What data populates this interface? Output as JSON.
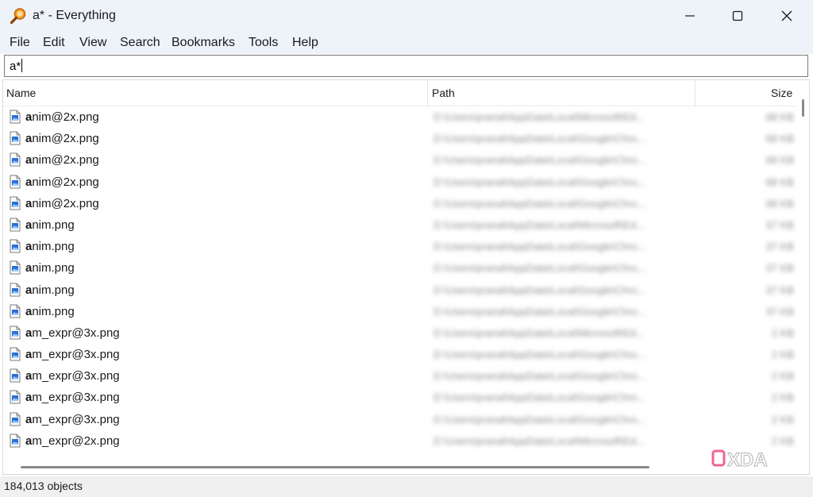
{
  "window": {
    "title": "a* - Everything"
  },
  "menu": [
    "File",
    "Edit",
    "View",
    "Search",
    "Bookmarks",
    "Tools",
    "Help"
  ],
  "search": {
    "value": "a*"
  },
  "columns": {
    "name": "Name",
    "path": "Path",
    "size": "Size"
  },
  "rows": [
    {
      "bold": "a",
      "rest": "nim@2x.png",
      "path": "D:\\Users\\pranal\\AppData\\Local\\Microsoft\\Ed...",
      "size": "68 KB"
    },
    {
      "bold": "a",
      "rest": "nim@2x.png",
      "path": "D:\\Users\\pranal\\AppData\\Local\\Google\\Chro...",
      "size": "68 KB"
    },
    {
      "bold": "a",
      "rest": "nim@2x.png",
      "path": "D:\\Users\\pranal\\AppData\\Local\\Google\\Chro...",
      "size": "68 KB"
    },
    {
      "bold": "a",
      "rest": "nim@2x.png",
      "path": "D:\\Users\\pranal\\AppData\\Local\\Google\\Chro...",
      "size": "68 KB"
    },
    {
      "bold": "a",
      "rest": "nim@2x.png",
      "path": "D:\\Users\\pranal\\AppData\\Local\\Google\\Chro...",
      "size": "68 KB"
    },
    {
      "bold": "a",
      "rest": "nim.png",
      "path": "D:\\Users\\pranal\\AppData\\Local\\Microsoft\\Ed...",
      "size": "37 KB"
    },
    {
      "bold": "a",
      "rest": "nim.png",
      "path": "D:\\Users\\pranal\\AppData\\Local\\Google\\Chro...",
      "size": "37 KB"
    },
    {
      "bold": "a",
      "rest": "nim.png",
      "path": "D:\\Users\\pranal\\AppData\\Local\\Google\\Chro...",
      "size": "37 KB"
    },
    {
      "bold": "a",
      "rest": "nim.png",
      "path": "D:\\Users\\pranal\\AppData\\Local\\Google\\Chro...",
      "size": "37 KB"
    },
    {
      "bold": "a",
      "rest": "nim.png",
      "path": "D:\\Users\\pranal\\AppData\\Local\\Google\\Chro...",
      "size": "37 KB"
    },
    {
      "bold": "a",
      "rest": "m_expr@3x.png",
      "path": "D:\\Users\\pranal\\AppData\\Local\\Microsoft\\Ed...",
      "size": "2 KB"
    },
    {
      "bold": "a",
      "rest": "m_expr@3x.png",
      "path": "D:\\Users\\pranal\\AppData\\Local\\Google\\Chro...",
      "size": "2 KB"
    },
    {
      "bold": "a",
      "rest": "m_expr@3x.png",
      "path": "D:\\Users\\pranal\\AppData\\Local\\Google\\Chro...",
      "size": "2 KB"
    },
    {
      "bold": "a",
      "rest": "m_expr@3x.png",
      "path": "D:\\Users\\pranal\\AppData\\Local\\Google\\Chro...",
      "size": "2 KB"
    },
    {
      "bold": "a",
      "rest": "m_expr@3x.png",
      "path": "D:\\Users\\pranal\\AppData\\Local\\Google\\Chro...",
      "size": "2 KB"
    },
    {
      "bold": "a",
      "rest": "m_expr@2x.png",
      "path": "D:\\Users\\pranal\\AppData\\Local\\Microsoft\\Ed...",
      "size": "2 KB"
    }
  ],
  "status": {
    "text": "184,013 objects"
  },
  "icons": {
    "app": "magnifier-icon",
    "file": "image-file-icon",
    "watermark": "xda-logo"
  },
  "colors": {
    "titlebar_bg": "#eef3fa",
    "icon_orange": "#e07a1a",
    "file_blue": "#2a6fd6",
    "watermark_pink": "#e8336e"
  }
}
